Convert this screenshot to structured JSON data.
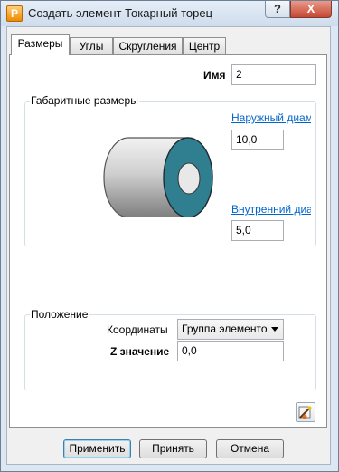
{
  "window": {
    "title": "Создать элемент Токарный торец",
    "app_icon": "P",
    "help": "?",
    "close": "X"
  },
  "tabs": [
    {
      "label": "Размеры",
      "active": true
    },
    {
      "label": "Углы",
      "active": false
    },
    {
      "label": "Скругления",
      "active": false
    },
    {
      "label": "Центр",
      "active": false
    }
  ],
  "name_field": {
    "label": "Имя",
    "value": "2"
  },
  "dimensions": {
    "legend": "Габаритные размеры",
    "outer": {
      "label": "Наружный диам",
      "value": "10,0"
    },
    "inner": {
      "label": "Внутренний диа",
      "value": "5,0"
    }
  },
  "position": {
    "legend": "Положение",
    "coords": {
      "label": "Координаты",
      "value": "Группа элементо"
    },
    "z": {
      "label": "Z значение",
      "value": "0,0"
    }
  },
  "buttons": {
    "apply": "Применить",
    "accept": "Принять",
    "cancel": "Отмена"
  },
  "colors": {
    "face": "#2f7f91",
    "body": "#c8c8c8",
    "accent": "#0066cc"
  }
}
